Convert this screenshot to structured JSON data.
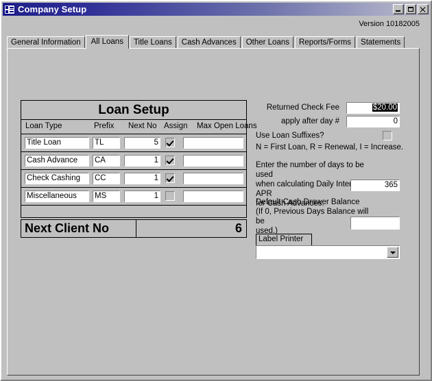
{
  "window": {
    "title": "Company Setup",
    "icon": "form-icon",
    "buttons": {
      "minimize": "minimize-icon",
      "maximize": "maximize-icon",
      "close": "close-icon"
    }
  },
  "header": {
    "version": "Version 10182005"
  },
  "tabs": [
    {
      "label": "General Information",
      "active": false
    },
    {
      "label": "All Loans",
      "active": true
    },
    {
      "label": "Title Loans",
      "active": false
    },
    {
      "label": "Cash Advances",
      "active": false
    },
    {
      "label": "Other Loans",
      "active": false
    },
    {
      "label": "Reports/Forms",
      "active": false
    },
    {
      "label": "Statements",
      "active": false
    }
  ],
  "loan_setup": {
    "title": "Loan Setup",
    "columns": {
      "loan_type": "Loan Type",
      "prefix": "Prefix",
      "next_no": "Next No",
      "assign": "Assign",
      "max_open_loans": "Max Open Loans"
    },
    "rows": [
      {
        "loan_type": "Title Loan",
        "prefix": "TL",
        "next_no": "5",
        "assign": true,
        "max_open_loans": ""
      },
      {
        "loan_type": "Cash Advance",
        "prefix": "CA",
        "next_no": "1",
        "assign": true,
        "max_open_loans": ""
      },
      {
        "loan_type": "Check Cashing",
        "prefix": "CC",
        "next_no": "1",
        "assign": true,
        "max_open_loans": ""
      },
      {
        "loan_type": "Miscellaneous",
        "prefix": "MS",
        "next_no": "1",
        "assign": false,
        "max_open_loans": ""
      }
    ],
    "footer": {
      "label": "Next Client No",
      "value": "6"
    }
  },
  "settings": {
    "returned_check_fee_label": "Returned Check Fee",
    "returned_check_fee_value": "$20.00",
    "returned_check_fee_selected": true,
    "apply_after_day_label": "apply after day #",
    "apply_after_day_value": "0",
    "use_loan_suffixes_label": "Use Loan Suffixes?",
    "use_loan_suffixes_checked": false,
    "suffix_legend": "N = First Loan, R = Renewal, I = Increase.",
    "days_note_line1": "Enter the number of days to be used",
    "days_note_line2": "when calculating Daily Interest and APR",
    "days_note_line3": "for Cash Advances.",
    "days_value": "365",
    "drawer_note_line1": "Default Cash Drawer Balance",
    "drawer_note_line2": "(If 0, Previous Days Balance will be",
    "drawer_note_line3": "used.)",
    "drawer_value": "",
    "label_printer_label": "Label Printer",
    "label_printer_value": ""
  }
}
